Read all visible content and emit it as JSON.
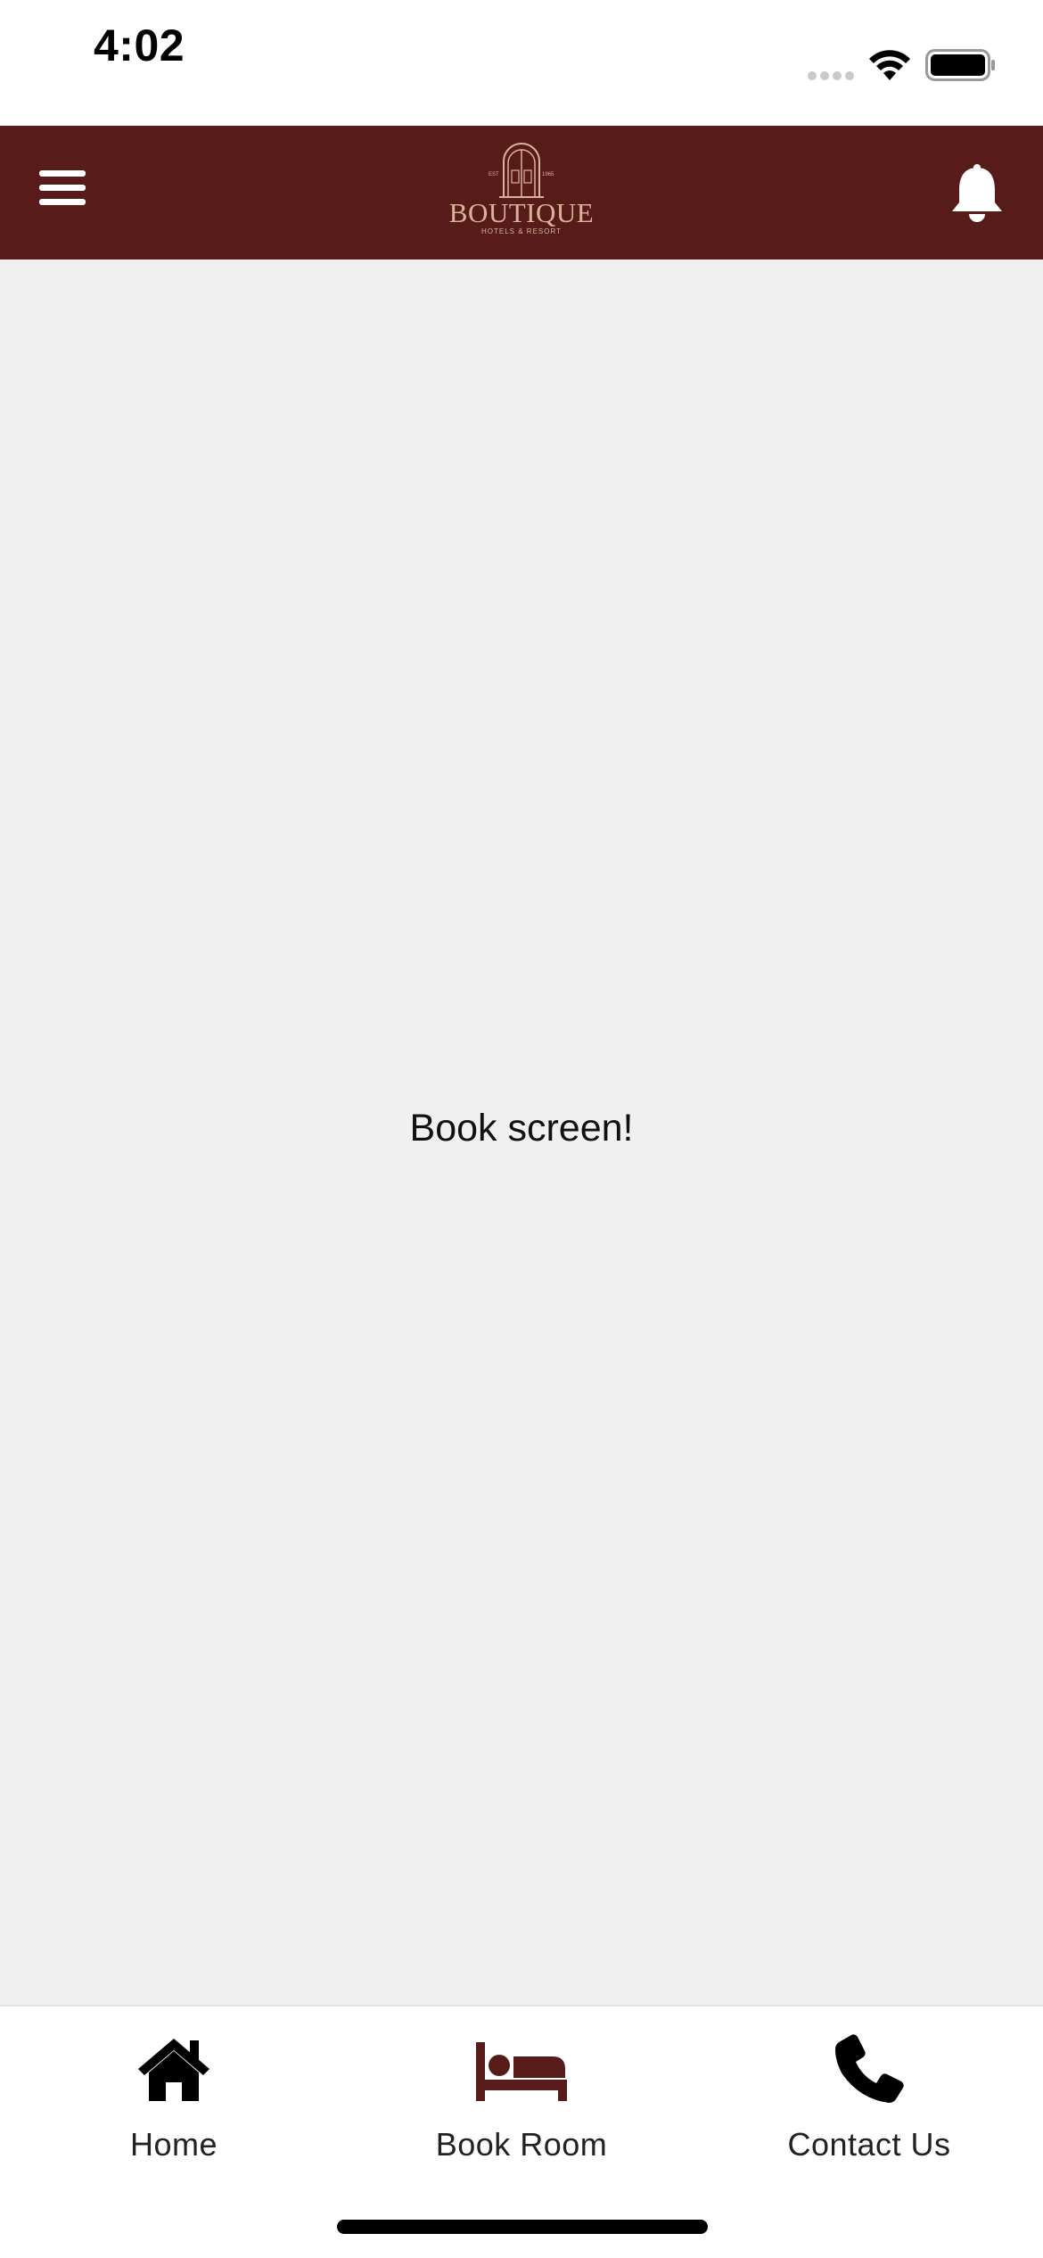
{
  "status_bar": {
    "time": "4:02",
    "icons": [
      "signal-icon",
      "wifi-icon",
      "battery-icon"
    ]
  },
  "header": {
    "menu_icon": "hamburger-menu-icon",
    "notification_icon": "bell-icon",
    "logo": {
      "name": "BOUTIQUE",
      "subtitle": "HOTELS & RESORT",
      "est_left": "EST",
      "est_right": "1965"
    },
    "background_color": "#571c1a",
    "logo_color": "#d9b49a"
  },
  "main": {
    "message": "Book screen!"
  },
  "tab_bar": {
    "tabs": [
      {
        "label": "Home",
        "icon": "home-icon",
        "active": false,
        "color": "#000000"
      },
      {
        "label": "Book Room",
        "icon": "bed-icon",
        "active": true,
        "color": "#571c1a"
      },
      {
        "label": "Contact Us",
        "icon": "phone-icon",
        "active": false,
        "color": "#000000"
      }
    ]
  }
}
